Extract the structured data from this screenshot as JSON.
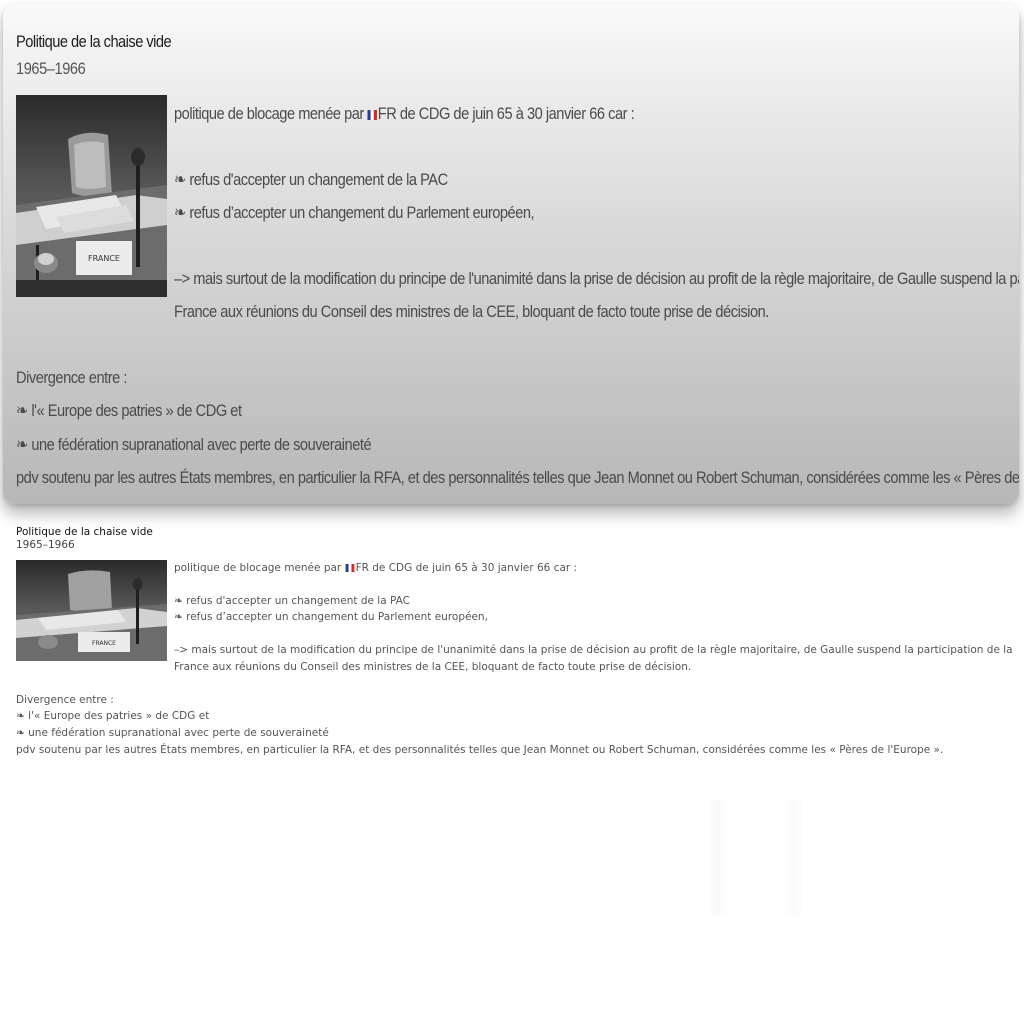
{
  "card": {
    "title": "Politique de la chaise vide",
    "years": "1965–1966",
    "intro_before_flag": "politique de blocage menée par ",
    "intro_after_flag": "FR de CDG de juin 65 à 30 janvier 66 car :",
    "refusals": [
      "❧ refus d'accepter un changement de la PAC",
      "❧ refus d’accepter un changement du Parlement européen,"
    ],
    "arrow_line_1": "–> mais surtout de la modification du principe de l'unanimité dans la prise de décision au profit de la règle majoritaire, de Gaulle suspend la participation de la",
    "arrow_line_2": "France aux réunions du Conseil des ministres de la CEE, bloquant de facto toute prise de décision.",
    "divergence_heading": "Divergence entre :",
    "divergence_items": [
      "❧ l'« Europe des patries » de CDG et",
      "❧ une fédération supranational avec perte de souveraineté"
    ],
    "closing": "pdv soutenu par les autres États membres, en particulier la RFA, et des personnalités telles que Jean Monnet ou Robert Schuman, considérées comme les « Pères de l'Europe »."
  },
  "colors": {
    "flag_blue": "#1f3d9b",
    "flag_white": "#ffffff",
    "flag_red": "#d62b2b"
  },
  "icons": {
    "flag": "france-flag-icon",
    "bullet": "fleuron"
  },
  "photo": {
    "caption_sign": "FRANCE"
  }
}
